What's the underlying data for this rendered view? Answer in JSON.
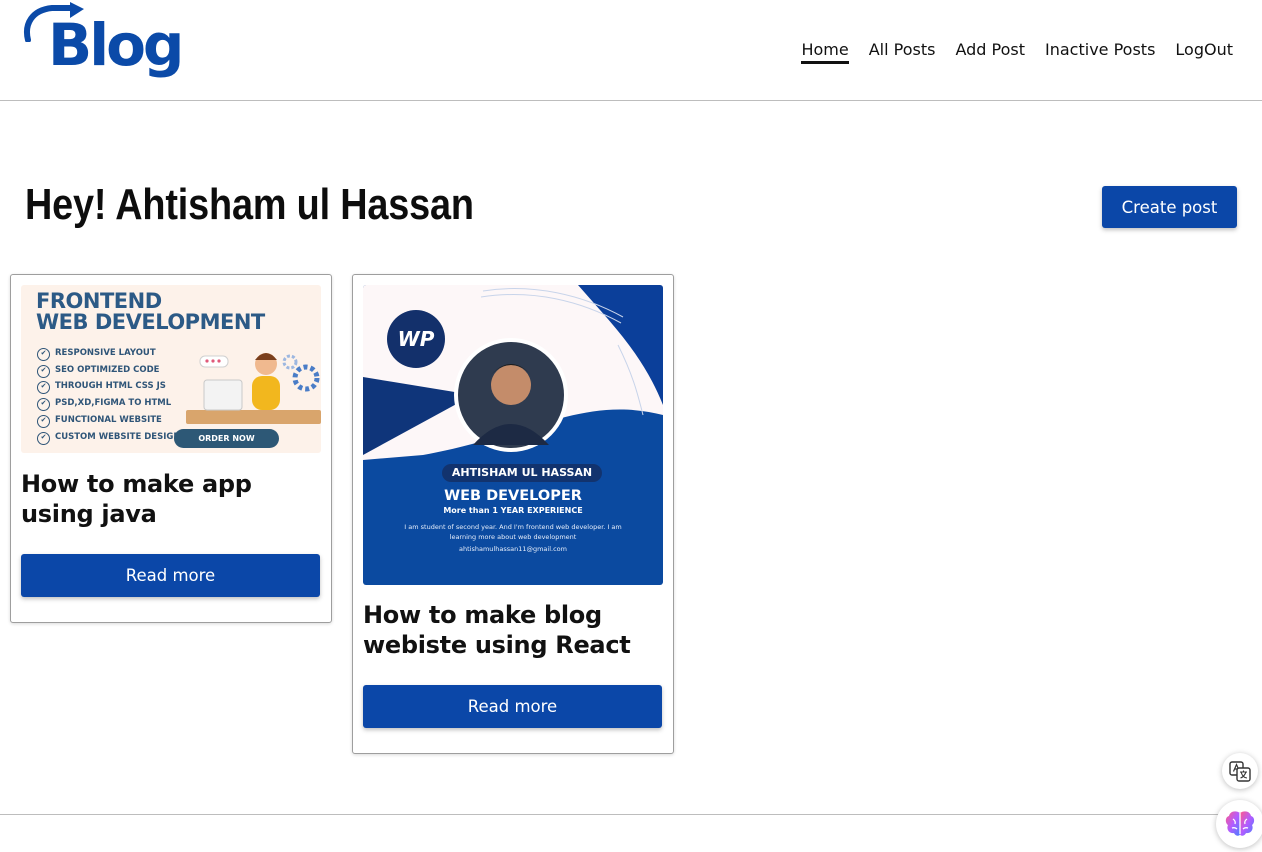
{
  "header": {
    "logo_text": "Blog",
    "nav": [
      {
        "label": "Home",
        "active": true
      },
      {
        "label": "All Posts",
        "active": false
      },
      {
        "label": "Add Post",
        "active": false
      },
      {
        "label": "Inactive Posts",
        "active": false
      },
      {
        "label": "LogOut",
        "active": false
      }
    ]
  },
  "main": {
    "greeting": "Hey! Ahtisham ul Hassan",
    "create_button": "Create post"
  },
  "posts": [
    {
      "title": "How to make app using java",
      "button": "Read more",
      "image": {
        "heading_line1": "FRONTEND",
        "heading_line2": "WEB DEVELOPMENT",
        "items": [
          "RESPONSIVE LAYOUT",
          "SEO OPTIMIZED CODE",
          "THROUGH HTML CSS JS",
          "PSD,XD,FIGMA TO HTML",
          "FUNCTIONAL WEBSITE",
          "CUSTOM WEBSITE DESIGN"
        ],
        "cta": "ORDER NOW"
      }
    },
    {
      "title": "How to make blog webiste using React",
      "button": "Read more",
      "image": {
        "badge": "WP",
        "name": "AHTISHAM UL HASSAN",
        "role": "WEB DEVELOPER",
        "experience": "More than 1 YEAR EXPERIENCE",
        "description": "I am student of second year. And I'm frontend web developer. I am learning more about web development",
        "email": "ahtishamulhassan11@gmail.com"
      }
    }
  ],
  "colors": {
    "primary": "#0b47a8",
    "logo": "#0b4aa8",
    "border": "#9e9e9e"
  },
  "widgets": {
    "translate_icon": "translate-icon",
    "brain_icon": "brain-icon"
  }
}
